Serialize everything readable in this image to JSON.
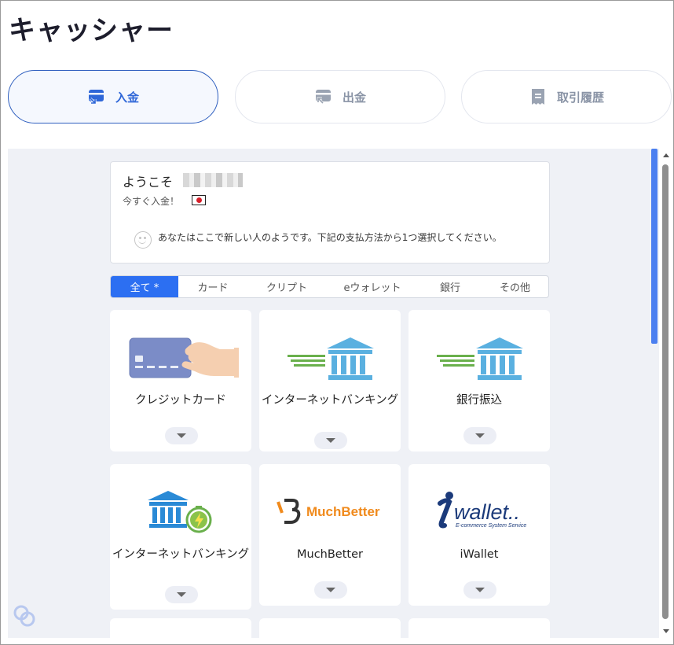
{
  "page": {
    "title": "キャッシャー"
  },
  "tabs": [
    {
      "label": "入金",
      "icon": "deposit-icon",
      "active": true
    },
    {
      "label": "出金",
      "icon": "withdraw-icon",
      "active": false
    },
    {
      "label": "取引履歴",
      "icon": "receipt-icon",
      "active": false
    }
  ],
  "welcome": {
    "greeting": "ようこそ",
    "sub": "今すぐ入金！",
    "message": "あなたはここで新しい人のようです。下記の支払方法から1つ選択してください。"
  },
  "filters": [
    {
      "label": "全て *",
      "active": true
    },
    {
      "label": "カード",
      "active": false
    },
    {
      "label": "クリプト",
      "active": false
    },
    {
      "label": "eウォレット",
      "active": false
    },
    {
      "label": "銀行",
      "active": false
    },
    {
      "label": "その他",
      "active": false
    }
  ],
  "methods": [
    {
      "label": "クレジットカード",
      "icon": "credit-card-hand-icon"
    },
    {
      "label": "インターネットバンキング",
      "icon": "bank-icon"
    },
    {
      "label": "銀行振込",
      "icon": "bank-icon"
    },
    {
      "label": "インターネットバンキング",
      "icon": "bank-fast-icon"
    },
    {
      "label": "MuchBetter",
      "icon": "muchbetter-logo",
      "logo_text": "MuchBetter"
    },
    {
      "label": "iWallet",
      "icon": "iwallet-logo",
      "logo_text": "wallet..",
      "logo_subtext": "E-commerce System Service"
    }
  ],
  "colors": {
    "accent": "#2c6ff2",
    "tab_active": "#2f67d8",
    "bank_blue": "#5ab0e0",
    "speed_green": "#6ab04c",
    "muchbetter_orange": "#f08a1c",
    "iwallet_navy": "#1b3a7a"
  }
}
